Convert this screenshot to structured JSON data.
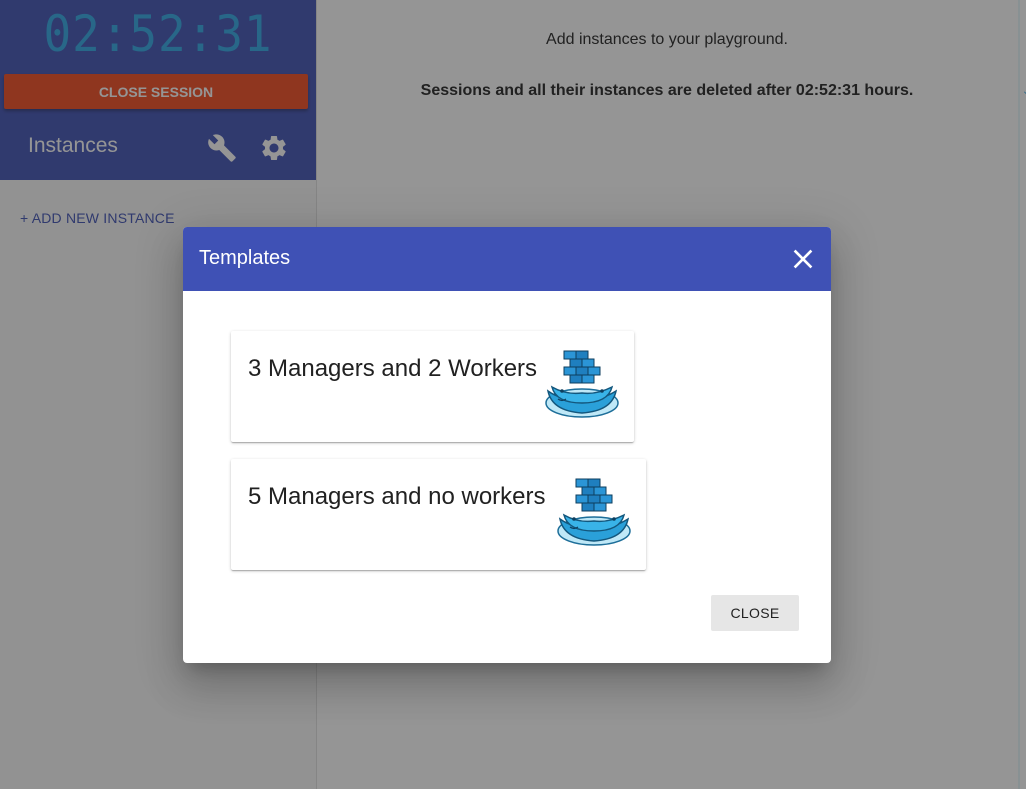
{
  "sidebar": {
    "timer": "02:52:31",
    "close_session_label": "CLOSE SESSION",
    "instances_title": "Instances",
    "add_instance_label": "+ ADD NEW INSTANCE"
  },
  "main": {
    "line1": "Add instances to your playground.",
    "line2": "Sessions and all their instances are deleted after 02:52:31 hours."
  },
  "dialog": {
    "title": "Templates",
    "templates": [
      {
        "label": "3 Managers and 2 Workers",
        "icon": "docker-swarm-whale-icon"
      },
      {
        "label": "5 Managers and no workers",
        "icon": "docker-swarm-whale-icon"
      }
    ],
    "close_label": "CLOSE"
  },
  "colors": {
    "primary": "#3f51b5",
    "accent_orange": "#f44a1d",
    "timer_blue": "#2ea7e6"
  }
}
